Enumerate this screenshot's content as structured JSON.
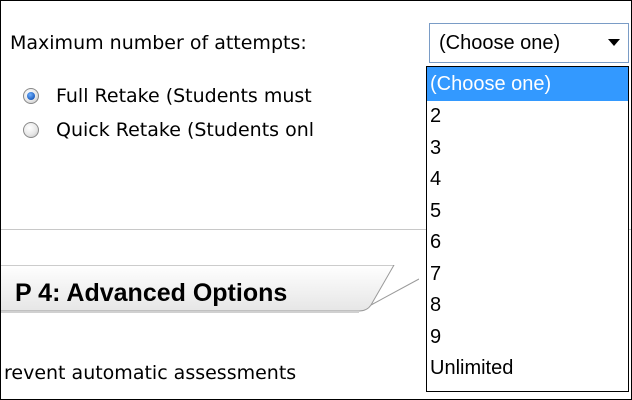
{
  "attempts": {
    "label": "Maximum number of attempts:",
    "selected_value": "(Choose one)",
    "options": [
      "(Choose one)",
      "2",
      "3",
      "4",
      "5",
      "6",
      "7",
      "8",
      "9",
      "Unlimited"
    ]
  },
  "retake_options": [
    {
      "label": "Full Retake (Students must",
      "checked": true
    },
    {
      "label": "Quick Retake (Students onl",
      "checked": false
    }
  ],
  "step": {
    "title": "P 4: Advanced Options"
  },
  "prevent_text": "revent automatic assessments",
  "colors": {
    "highlight": "#3399ff",
    "select_border": "#7a9cc6"
  },
  "icons": {
    "dropdown_arrow": "chevron-down-icon"
  }
}
